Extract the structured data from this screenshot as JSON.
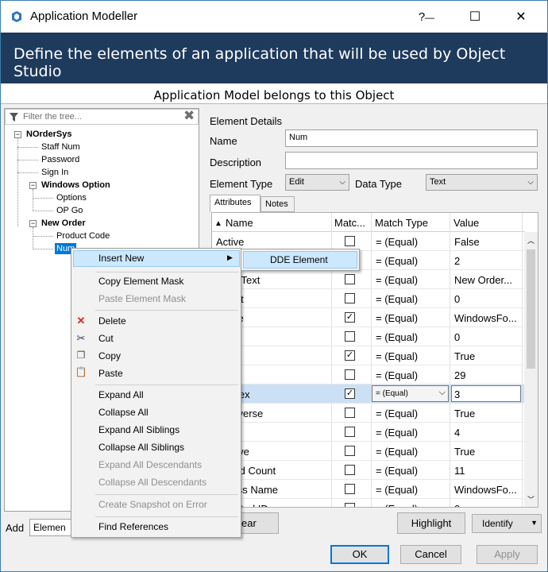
{
  "window": {
    "title": "Application Modeller",
    "help_btn": "?",
    "minimize_btn": "—",
    "maximize_btn": "☐",
    "close_btn": "✕"
  },
  "banner": "Define the elements of an application that will be used by Object Studio",
  "subheader": "Application Model belongs to this Object",
  "tree": {
    "filter_placeholder": "Filter the tree...",
    "nodes": [
      {
        "label": "NOrderSys",
        "bold": true
      },
      {
        "label": "Staff Num"
      },
      {
        "label": "Password"
      },
      {
        "label": "Sign In"
      },
      {
        "label": "Windows Option",
        "bold": true
      },
      {
        "label": "Options"
      },
      {
        "label": "OP Go"
      },
      {
        "label": "New Order",
        "bold": true
      },
      {
        "label": "Product Code"
      },
      {
        "label": "Num"
      }
    ]
  },
  "details": {
    "heading": "Element Details",
    "name_label": "Name",
    "name_value": "Num",
    "description_label": "Description",
    "description_value": "",
    "element_type_label": "Element Type",
    "element_type_value": "Edit",
    "data_type_label": "Data Type",
    "data_type_value": "Text"
  },
  "tabs": [
    {
      "label": "Attributes"
    },
    {
      "label": "Notes"
    }
  ],
  "grid": {
    "headers": [
      "Name",
      "Matc...",
      "Match Type",
      "Value"
    ],
    "rows": [
      {
        "name": "Active",
        "checked": false,
        "match": "=  (Equal)",
        "value": "False"
      },
      {
        "name": "",
        "checked": false,
        "match": "=  (Equal)",
        "value": "2"
      },
      {
        "name": "stors Text",
        "checked": false,
        "match": "=  (Equal)",
        "value": "New Order..."
      },
      {
        "name": "Count",
        "checked": false,
        "match": "=  (Equal)",
        "value": "0"
      },
      {
        "name": "Name",
        "checked": true,
        "match": "=  (Equal)",
        "value": "WindowsFo..."
      },
      {
        "name": "rol ID",
        "checked": false,
        "match": "=  (Equal)",
        "value": "0"
      },
      {
        "name": "ed",
        "checked": true,
        "match": "=  (Equal)",
        "value": "True"
      },
      {
        "name": "nt",
        "checked": false,
        "match": "=  (Equal)",
        "value": "29"
      },
      {
        "name": "h Index",
        "checked": true,
        "match": "=  (Equal)",
        "value": "3",
        "selected": true
      },
      {
        "name": "h Reverse",
        "checked": false,
        "match": "=  (Equal)",
        "value": "True"
      },
      {
        "name": "al",
        "checked": false,
        "match": "=  (Equal)",
        "value": "4"
      },
      {
        "name": "t Active",
        "checked": false,
        "match": "=  (Equal)",
        "value": "True"
      },
      {
        "name": "t Child Count",
        "checked": false,
        "match": "=  (Equal)",
        "value": "11"
      },
      {
        "name": "t Class Name",
        "checked": false,
        "match": "=  (Equal)",
        "value": "WindowsFo..."
      },
      {
        "name": "t Control ID",
        "checked": false,
        "match": "=  (Equal)",
        "value": "0"
      }
    ]
  },
  "bottom": {
    "add_label": "Add",
    "add_combo": "Elemen",
    "clear_btn": "ear",
    "highlight_btn": "Highlight",
    "identify_btn": "Identify",
    "ok_btn": "OK",
    "cancel_btn": "Cancel",
    "apply_btn": "Apply"
  },
  "context_menu": {
    "items": [
      {
        "label": "Insert New",
        "submenu": true
      },
      {
        "label": "Copy Element Mask"
      },
      {
        "label": "Paste Element Mask",
        "disabled": true
      },
      {
        "label": "Delete",
        "icon": "delete-icon"
      },
      {
        "label": "Cut",
        "icon": "cut-icon"
      },
      {
        "label": "Copy",
        "icon": "copy-icon"
      },
      {
        "label": "Paste",
        "icon": "paste-icon"
      },
      {
        "label": "Expand All"
      },
      {
        "label": "Collapse All"
      },
      {
        "label": "Expand All Siblings"
      },
      {
        "label": "Collapse All Siblings"
      },
      {
        "label": "Expand All Descendants",
        "disabled": true
      },
      {
        "label": "Collapse All Descendants",
        "disabled": true
      },
      {
        "label": "Create Snapshot on Error",
        "disabled": true
      },
      {
        "label": "Find References"
      }
    ],
    "submenu_item": "DDE Element"
  },
  "colors": {
    "banner": "#1e3a5c",
    "accent": "#0078d7",
    "highlight": "#cce0f5"
  }
}
